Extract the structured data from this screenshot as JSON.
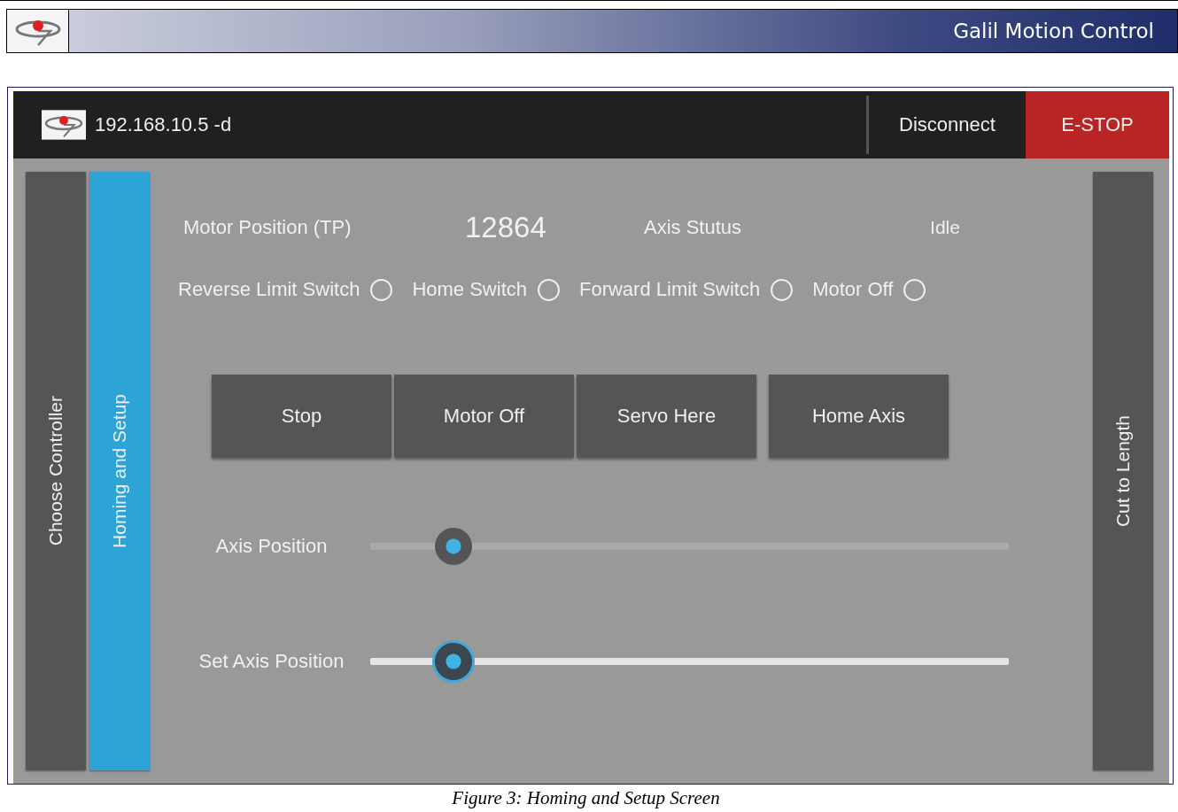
{
  "header": {
    "title": "Galil Motion Control"
  },
  "app": {
    "connection": "192.168.10.5 -d",
    "disconnect": "Disconnect",
    "estop": "E-STOP"
  },
  "left_tabs": [
    {
      "label": "Choose Controller",
      "selected": false
    },
    {
      "label": "Homing and Setup",
      "selected": true
    }
  ],
  "right_tabs": [
    {
      "label": "Cut to Length",
      "selected": false
    }
  ],
  "status": [
    {
      "label": "Motor Position (TP)",
      "value": "12864"
    },
    {
      "label": "Axis Stutus",
      "value": "Idle"
    }
  ],
  "switches": [
    {
      "label": "Reverse Limit Switch",
      "on": false
    },
    {
      "label": "Home Switch",
      "on": false
    },
    {
      "label": "Forward Limit Switch",
      "on": false
    },
    {
      "label": "Motor Off",
      "on": false
    }
  ],
  "buttons": [
    "Stop",
    "Motor Off",
    "Servo Here",
    "Home Axis"
  ],
  "sliders": [
    {
      "label": "Axis Position",
      "kind": "readout",
      "level": 0.13
    },
    {
      "label": "Set Axis Position",
      "kind": "control",
      "level": 0.13
    }
  ],
  "caption": "Figure 3: Homing and Setup Screen"
}
